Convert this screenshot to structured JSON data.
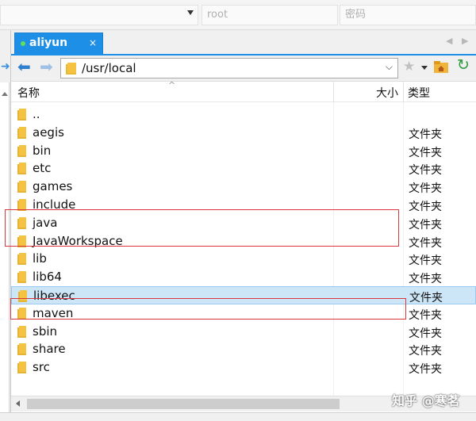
{
  "connection": {
    "host_placeholder": "",
    "user_placeholder": "root",
    "password_placeholder": "密码"
  },
  "tab": {
    "label": "aliyun",
    "close_glyph": "×",
    "status_color": "#5fe05f"
  },
  "toolbar": {
    "back_glyph": "⬅",
    "forward_glyph": "➡",
    "path": "/usr/local",
    "dropdown_glyph": "⌵",
    "bookmark_glyph": "★",
    "refresh_glyph": "↻"
  },
  "columns": {
    "name": "名称",
    "size": "大小",
    "type": "类型"
  },
  "files": [
    {
      "name": "..",
      "type": ""
    },
    {
      "name": "aegis",
      "type": "文件夹"
    },
    {
      "name": "bin",
      "type": "文件夹"
    },
    {
      "name": "etc",
      "type": "文件夹"
    },
    {
      "name": "games",
      "type": "文件夹"
    },
    {
      "name": "include",
      "type": "文件夹"
    },
    {
      "name": "java",
      "type": "文件夹"
    },
    {
      "name": "JavaWorkspace",
      "type": "文件夹"
    },
    {
      "name": "lib",
      "type": "文件夹"
    },
    {
      "name": "lib64",
      "type": "文件夹"
    },
    {
      "name": "libexec",
      "type": "文件夹"
    },
    {
      "name": "maven",
      "type": "文件夹"
    },
    {
      "name": "sbin",
      "type": "文件夹"
    },
    {
      "name": "share",
      "type": "文件夹"
    },
    {
      "name": "src",
      "type": "文件夹"
    }
  ],
  "selected_file": "libexec",
  "annotations": [
    "java",
    "JavaWorkspace",
    "maven"
  ],
  "watermark": "知乎 @寒茗",
  "colors": {
    "accent": "#1e8fe6",
    "selection": "#cde6f7",
    "annotation": "#d9363e",
    "folder": "#f5c242"
  }
}
